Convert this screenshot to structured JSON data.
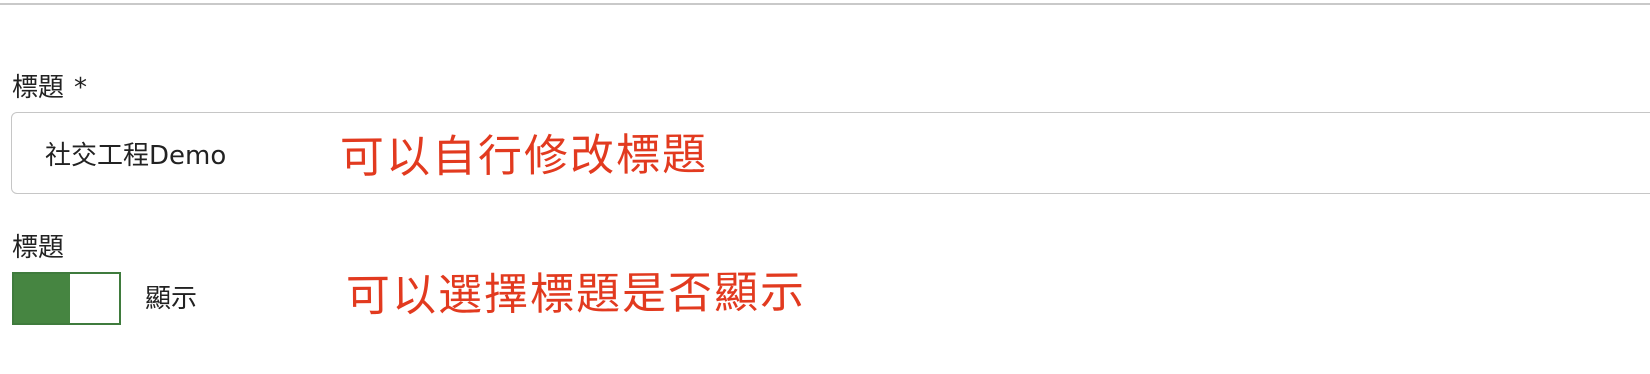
{
  "title_field": {
    "label": "標題",
    "required_mark": "*",
    "value": "社交工程Demo"
  },
  "title_visibility": {
    "label": "標題",
    "state": "on",
    "state_text": "顯示"
  },
  "annotations": {
    "edit_title_note": "可以自行修改標題",
    "toggle_title_note": "可以選擇標題是否顯示"
  },
  "colors": {
    "annotation": "#e23a1f",
    "toggle_on": "#468541",
    "toggle_border": "#3f7b3d",
    "input_border": "#c6c6c6"
  }
}
